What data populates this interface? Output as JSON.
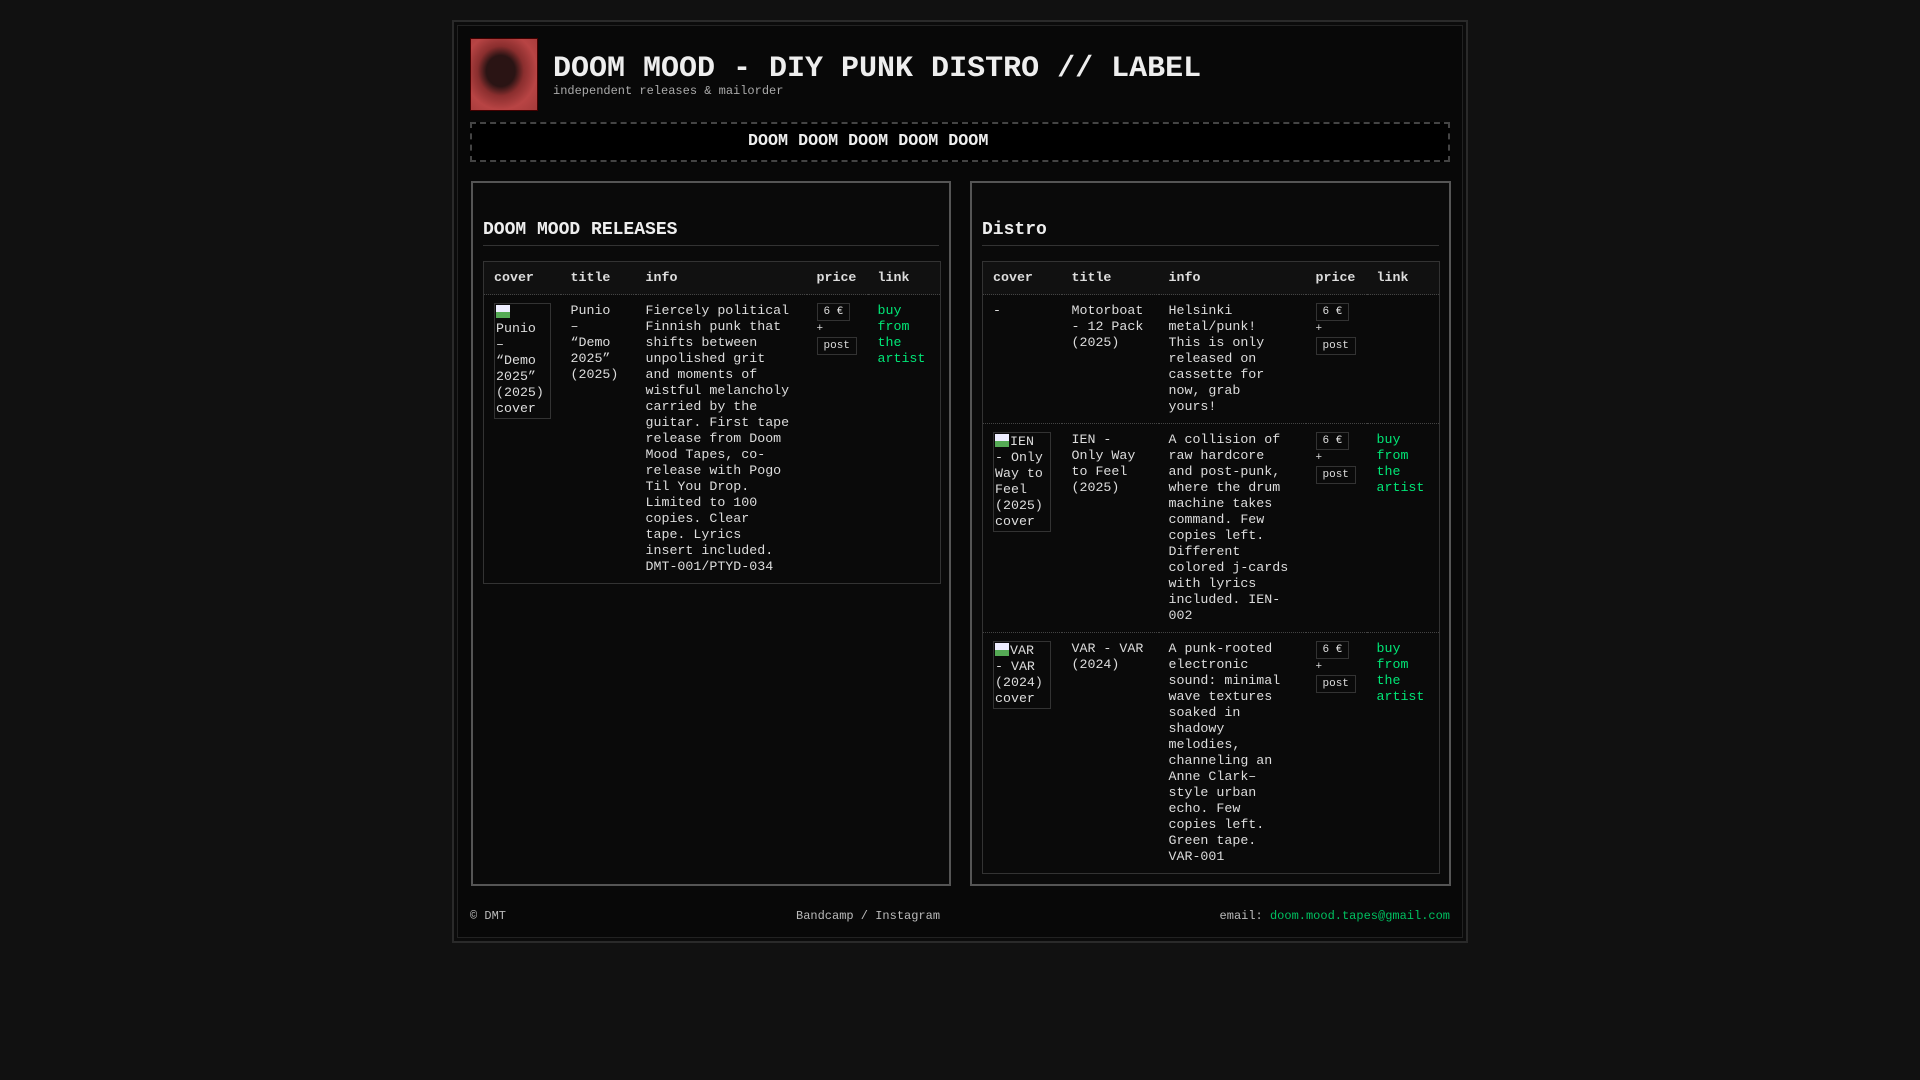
{
  "header": {
    "title": "DOOM MOOD - DIY PUNK DISTRO // LABEL",
    "subtitle": "independent releases & mailorder",
    "marquee": "DOOM DOOM DOOM DOOM DOOM"
  },
  "columns": [
    "cover",
    "title",
    "info",
    "price",
    "link"
  ],
  "releases": {
    "heading": "DOOM MOOD RELEASES",
    "rows": [
      {
        "cover_alt": "Punio – “Demo 2025” (2025) cover",
        "title": "Punio – “Demo 2025” (2025)",
        "info": "Fiercely political Finnish punk that shifts between unpolished grit and moments of wistful melancholy carried by the guitar. First tape release from Doom Mood Tapes, co-release with Pogo Til You Drop. Limited to 100 copies. Clear tape. Lyrics insert included. DMT-001/PTYD-034",
        "price": "6 €",
        "plus": "+",
        "post": "post",
        "link": "buy from the artist"
      }
    ]
  },
  "distro": {
    "heading": "Distro",
    "rows": [
      {
        "cover_alt": "-",
        "title": "Motorboat - 12 Pack (2025)",
        "info": "Helsinki metal/punk! This is only released on cassette for now, grab yours!",
        "price": "6 €",
        "plus": "+",
        "post": "post",
        "link": ""
      },
      {
        "cover_alt": "IEN - Only Way to Feel (2025) cover",
        "title": "IEN - Only Way to Feel (2025)",
        "info": "A collision of raw hardcore and post-punk, where the drum machine takes command. Few copies left. Different colored j-cards with lyrics included. IEN-002",
        "price": "6 €",
        "plus": "+",
        "post": "post",
        "link": "buy from the artist"
      },
      {
        "cover_alt": "VAR - VAR (2024) cover",
        "title": "VAR - VAR (2024)",
        "info": "A punk-rooted electronic sound: minimal wave textures soaked in shadowy melodies, channeling an Anne Clark–style urban echo. Few copies left. Green tape. VAR-001",
        "price": "6 €",
        "plus": "+",
        "post": "post",
        "link": "buy from the artist"
      }
    ]
  },
  "footer": {
    "copyright": "© DMT",
    "social": "Bandcamp / Instagram",
    "email_label": "email:",
    "email": "doom.mood.tapes@gmail.com"
  },
  "colors": {
    "link": "#00e676",
    "logo": "#b84444"
  }
}
